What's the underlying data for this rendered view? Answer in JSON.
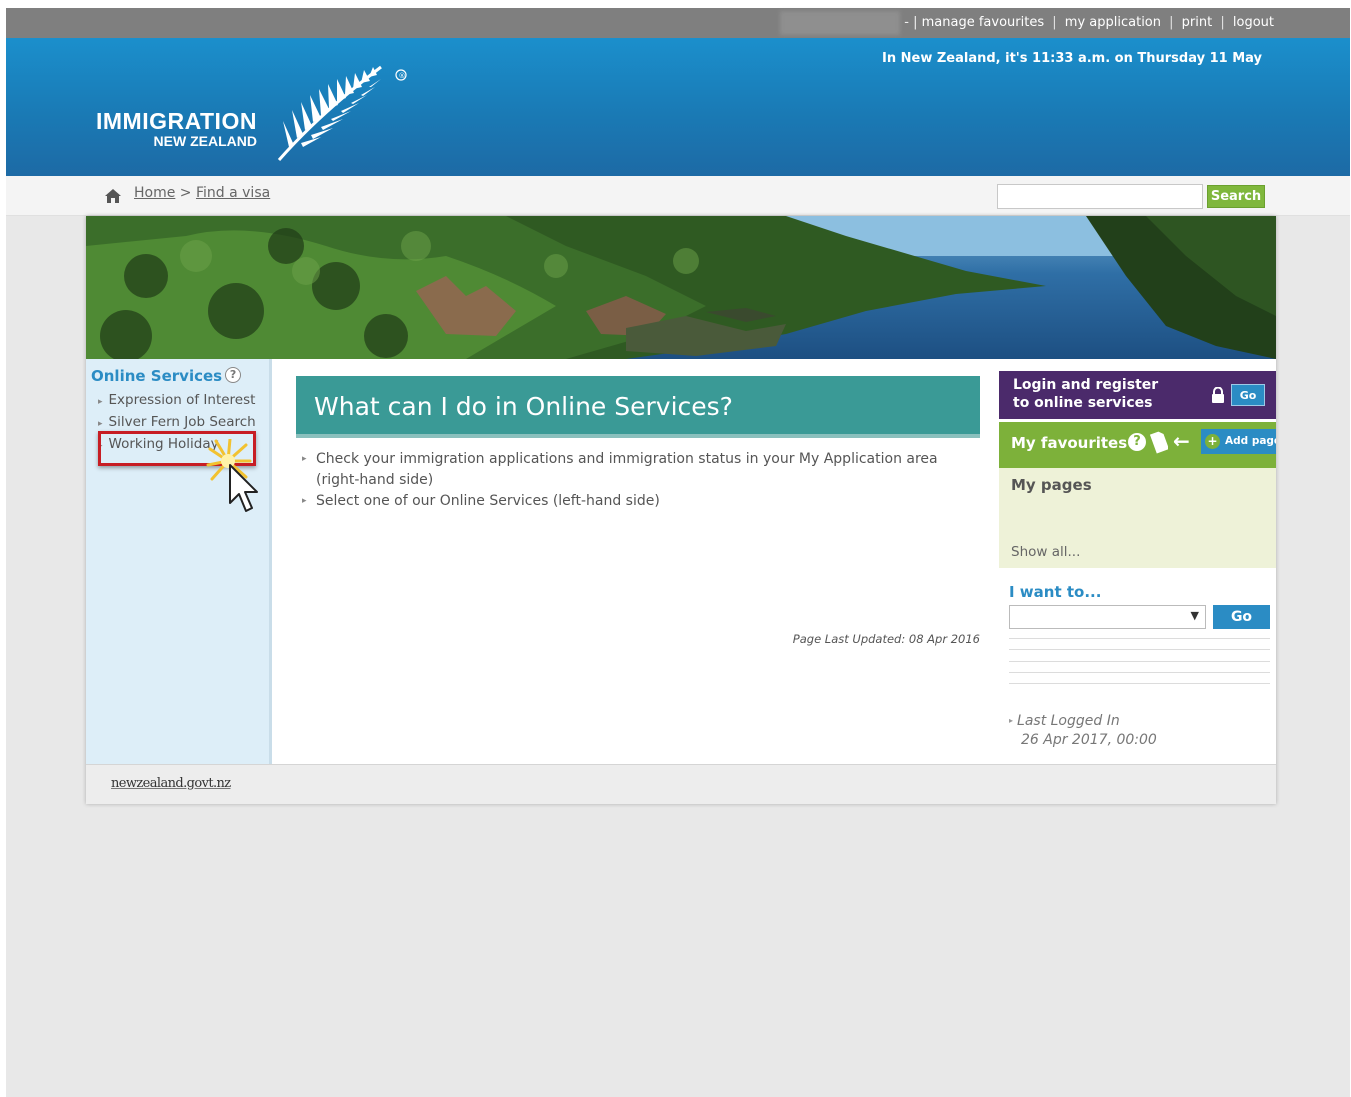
{
  "utility_bar": {
    "prefix": "- |",
    "links": [
      "manage favourites",
      "my application",
      "print",
      "logout"
    ]
  },
  "header": {
    "logo_line1": "IMMIGRATION",
    "logo_line2": "NEW ZEALAND",
    "datetime": "In New Zealand, it's 11:33 a.m. on Thursday 11 May"
  },
  "breadcrumb": {
    "home": "Home",
    "separator": ">",
    "current": "Find a visa"
  },
  "search": {
    "placeholder": "",
    "button_label": "Search"
  },
  "left_nav": {
    "title": "Online Services",
    "help": "?",
    "items": [
      {
        "label": "Expression of Interest"
      },
      {
        "label": "Silver Fern Job Search"
      },
      {
        "label": "Working Holiday"
      }
    ]
  },
  "main": {
    "heading": "What can I do in Online Services?",
    "bullets": [
      "Check your immigration applications and immigration status in your My Application area (right-hand side)",
      "Select one of our Online Services (left-hand side)"
    ],
    "last_updated": "Page Last Updated: 08 Apr 2016"
  },
  "right_column": {
    "login_line1": "Login and register",
    "login_line2": "to online services",
    "login_go": "Go",
    "favourites_label": "My favourites",
    "favourites_help": "?",
    "add_page": "Add page",
    "my_pages_title": "My pages",
    "show_all": "Show all...",
    "i_want_to": "I want to...",
    "i_want_select_value": "",
    "i_want_go": "Go",
    "last_logged_label": "Last Logged In",
    "last_logged_value": "26 Apr 2017, 00:00"
  },
  "footer": {
    "brand": "newzealand.govt.nz"
  },
  "colors": {
    "header_blue": "#1a7ab5",
    "teal": "#3a9a96",
    "purple": "#4b2a6b",
    "green": "#7db13a",
    "link_blue": "#2b8cc4",
    "highlight_red": "#c71d24"
  }
}
